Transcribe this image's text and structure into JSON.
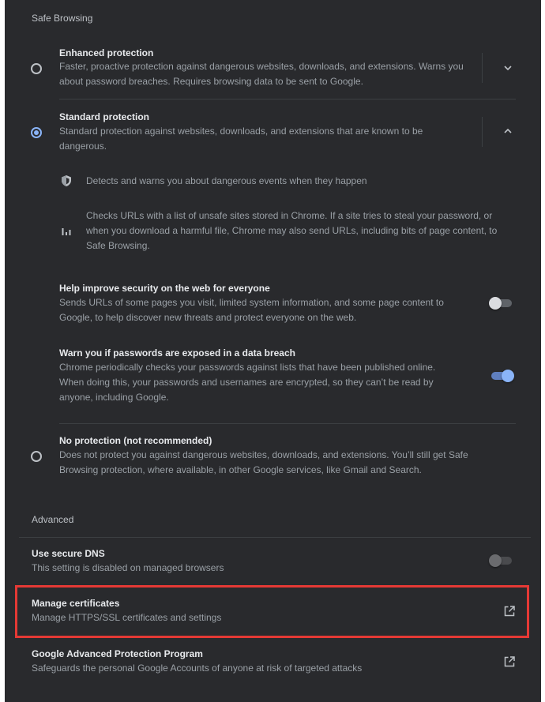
{
  "safe_browsing": {
    "header": "Safe Browsing",
    "enhanced": {
      "title": "Enhanced protection",
      "desc": "Faster, proactive protection against dangerous websites, downloads, and extensions. Warns you about password breaches. Requires browsing data to be sent to Google."
    },
    "standard": {
      "title": "Standard protection",
      "desc": "Standard protection against websites, downloads, and extensions that are known to be dangerous.",
      "bullets": [
        "Detects and warns you about dangerous events when they happen",
        "Checks URLs with a list of unsafe sites stored in Chrome. If a site tries to steal your password, or when you download a harmful file, Chrome may also send URLs, including bits of page content, to Safe Browsing."
      ],
      "help_improve": {
        "title": "Help improve security on the web for everyone",
        "desc": "Sends URLs of some pages you visit, limited system information, and some page content to Google, to help discover new threats and protect everyone on the web.",
        "enabled": false
      },
      "warn_passwords": {
        "title": "Warn you if passwords are exposed in a data breach",
        "desc": "Chrome periodically checks your passwords against lists that have been published online. When doing this, your passwords and usernames are encrypted, so they can’t be read by anyone, including Google.",
        "enabled": true
      }
    },
    "none": {
      "title": "No protection (not recommended)",
      "desc": "Does not protect you against dangerous websites, downloads, and extensions. You’ll still get Safe Browsing protection, where available, in other Google services, like Gmail and Search."
    },
    "selected": "standard"
  },
  "advanced": {
    "header": "Advanced",
    "secure_dns": {
      "title": "Use secure DNS",
      "desc": "This setting is disabled on managed browsers",
      "enabled": false
    },
    "manage_certificates": {
      "title": "Manage certificates",
      "desc": "Manage HTTPS/SSL certificates and settings"
    },
    "gapp": {
      "title": "Google Advanced Protection Program",
      "desc": "Safeguards the personal Google Accounts of anyone at risk of targeted attacks"
    }
  },
  "colors": {
    "background": "#292a2d",
    "accent": "#8ab4f8",
    "highlight": "#e53935"
  },
  "icons": {
    "shield": "shield-icon",
    "chart": "bar-chart-icon",
    "chevron_down": "chevron-down-icon",
    "chevron_up": "chevron-up-icon",
    "external": "open-in-new-icon"
  }
}
